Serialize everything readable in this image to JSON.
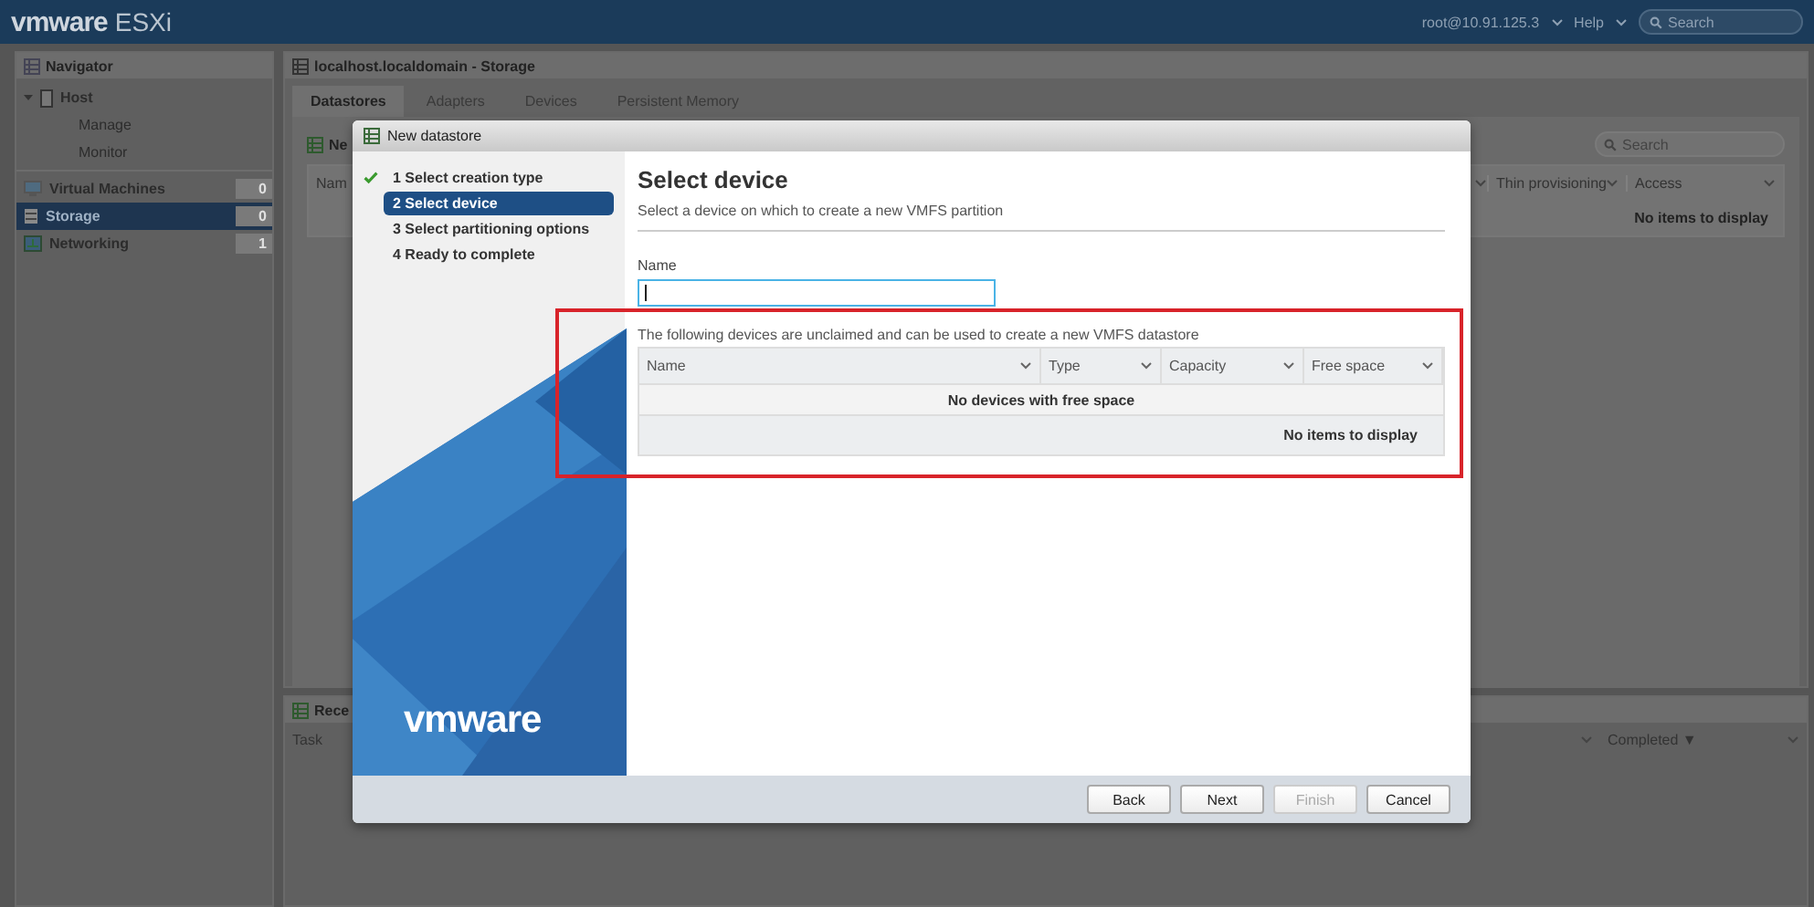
{
  "header": {
    "logo": "vmware",
    "product": "ESXi",
    "user": "root@10.91.125.3",
    "help": "Help",
    "search_placeholder": "Search"
  },
  "navigator": {
    "title": "Navigator",
    "items": [
      {
        "label": "Host",
        "expanded": true,
        "selected": false,
        "children": [
          {
            "label": "Manage",
            "selected": false
          },
          {
            "label": "Monitor",
            "selected": false
          }
        ]
      },
      {
        "label": "Virtual Machines",
        "count": "0",
        "selected": false
      },
      {
        "label": "Storage",
        "count": "0",
        "selected": true
      },
      {
        "label": "Networking",
        "count": "1",
        "selected": false
      }
    ]
  },
  "main": {
    "title": "localhost.localdomain - Storage",
    "tabs": [
      {
        "label": "Datastores",
        "selected": true
      },
      {
        "label": "Adapters",
        "selected": false
      },
      {
        "label": "Devices",
        "selected": false
      },
      {
        "label": "Persistent Memory",
        "selected": false
      }
    ],
    "toolbar_button": "Ne",
    "search_placeholder": "Search",
    "columns": [
      "Nam",
      "Thin provisioning",
      "Access"
    ],
    "empty": "No items to display"
  },
  "recent_tasks": {
    "title": "Rece",
    "columns": [
      "Task",
      "Completed ▼"
    ]
  },
  "dialog": {
    "title": "New datastore",
    "logo": "vmware",
    "steps": [
      {
        "label": "1 Select creation type",
        "done": true,
        "selected": false
      },
      {
        "label": "2 Select device",
        "done": false,
        "selected": true
      },
      {
        "label": "3 Select partitioning options",
        "done": false,
        "selected": false
      },
      {
        "label": "4 Ready to complete",
        "done": false,
        "selected": false
      }
    ],
    "heading": "Select device",
    "subtitle": "Select a device on which to create a new VMFS partition",
    "name_label": "Name",
    "note": "The following devices are unclaimed and can be used to create a new VMFS datastore",
    "columns": [
      "Name",
      "Type",
      "Capacity",
      "Free space"
    ],
    "empty_row": "No devices with free space",
    "footer": "No items to display",
    "buttons": [
      {
        "label": "Back",
        "disabled": false
      },
      {
        "label": "Next",
        "disabled": false
      },
      {
        "label": "Finish",
        "disabled": true
      },
      {
        "label": "Cancel",
        "disabled": false
      }
    ]
  }
}
